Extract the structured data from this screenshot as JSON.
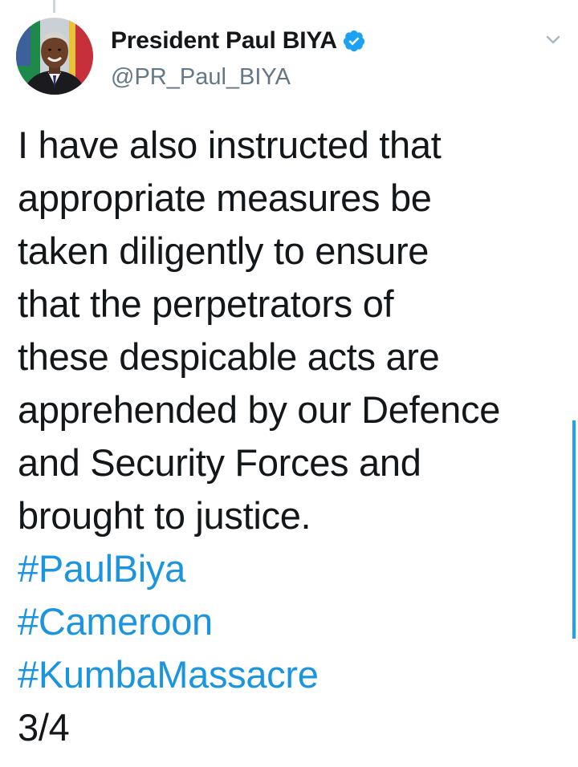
{
  "tweet": {
    "display_name": "President Paul BIYA",
    "handle": "@PR_Paul_BIYA",
    "verified": true,
    "body_lines": [
      "I have also instructed that",
      "appropriate measures be",
      "taken diligently to ensure",
      "that the perpetrators of",
      "these despicable acts are",
      "apprehended by our Defence",
      "and Security Forces and",
      "brought to justice."
    ],
    "hashtags": [
      "#PaulBiya",
      "#Cameroon",
      "#KumbaMassacre"
    ],
    "thread_counter": "3/4"
  },
  "icons": {
    "verified": "verified-badge-icon",
    "caret": "chevron-down-icon"
  },
  "colors": {
    "text": "#14171a",
    "secondary": "#657786",
    "link": "#1b95e0",
    "verified": "#1da1f2",
    "thread_line": "#ccd6dd"
  }
}
